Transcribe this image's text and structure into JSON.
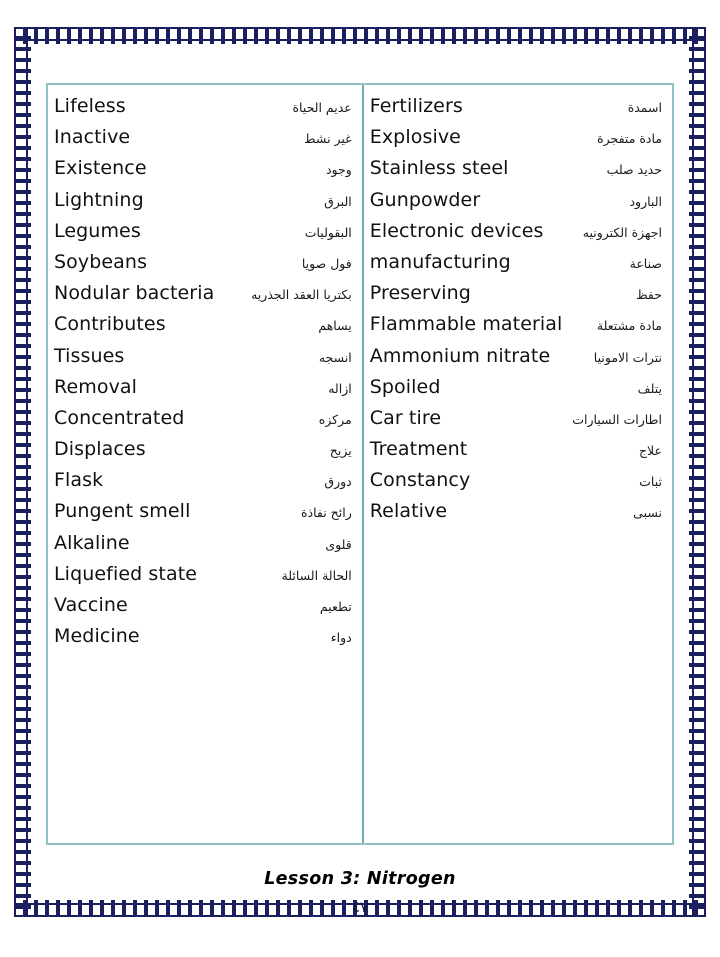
{
  "document": {
    "footer_label": "Lesson 3: Nitrogen",
    "page_number": "٤٧",
    "frame_color": "#1b1f5e",
    "table_border_color": "#8fc0c6",
    "table_divider_color": "#6fa9b0"
  },
  "vocabulary": {
    "left_column": [
      {
        "english": "Lifeless",
        "arabic": "عديم الحياة"
      },
      {
        "english": "Inactive",
        "arabic": "غير نشط"
      },
      {
        "english": "Existence",
        "arabic": "وجود"
      },
      {
        "english": "Lightning",
        "arabic": "البرق"
      },
      {
        "english": "Legumes",
        "arabic": "البقوليات"
      },
      {
        "english": "Soybeans",
        "arabic": "فول صويا"
      },
      {
        "english": "Nodular bacteria",
        "arabic": "بكتريا العقد الجذريه"
      },
      {
        "english": "Contributes",
        "arabic": "يساهم"
      },
      {
        "english": "Tissues",
        "arabic": "انسجه"
      },
      {
        "english": "Removal",
        "arabic": "ازاله"
      },
      {
        "english": "Concentrated",
        "arabic": "مركزه"
      },
      {
        "english": "Displaces",
        "arabic": "يزيح"
      },
      {
        "english": "Flask",
        "arabic": "دورق"
      },
      {
        "english": "Pungent smell",
        "arabic": "رائح نفاذة"
      },
      {
        "english": "Alkaline",
        "arabic": "قلوى"
      },
      {
        "english": "Liquefied state",
        "arabic": "الحالة السائلة"
      },
      {
        "english": "Vaccine",
        "arabic": "تطعيم"
      },
      {
        "english": "Medicine",
        "arabic": "دواء"
      }
    ],
    "right_column": [
      {
        "english": "Fertilizers",
        "arabic": "اسمدة"
      },
      {
        "english": "Explosive",
        "arabic": "مادة متفجرة"
      },
      {
        "english": "Stainless steel",
        "arabic": "حديد صلب"
      },
      {
        "english": "Gunpowder",
        "arabic": "البارود"
      },
      {
        "english": "Electronic devices",
        "arabic": "اجهزة الكترونيه"
      },
      {
        "english": "manufacturing",
        "arabic": "صناعة"
      },
      {
        "english": "Preserving",
        "arabic": "حفظ"
      },
      {
        "english": "Flammable material",
        "arabic": "مادة مشتعلة"
      },
      {
        "english": "Ammonium nitrate",
        "arabic": "نترات الامونيا"
      },
      {
        "english": "Spoiled",
        "arabic": "يتلف"
      },
      {
        "english": "Car tire",
        "arabic": "اطارات السيارات"
      },
      {
        "english": "Treatment",
        "arabic": "علاج"
      },
      {
        "english": "Constancy",
        "arabic": "ثبات"
      },
      {
        "english": "Relative",
        "arabic": "نسبى"
      }
    ]
  }
}
